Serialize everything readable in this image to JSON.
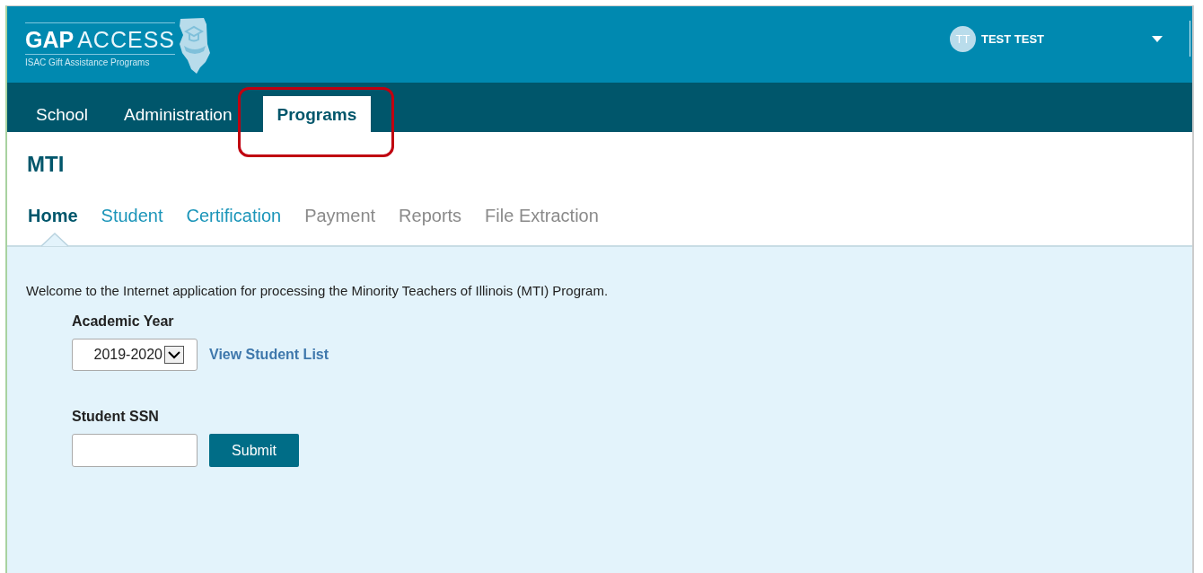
{
  "logo": {
    "brand_bold": "GAP",
    "brand_light": "ACCESS",
    "tagline": "ISAC Gift Assistance Programs"
  },
  "user": {
    "initials": "TT",
    "name": "TEST TEST"
  },
  "main_tabs": [
    {
      "label": "School",
      "selected": false
    },
    {
      "label": "Administration",
      "selected": false
    },
    {
      "label": "Programs",
      "selected": true,
      "highlighted": true
    }
  ],
  "page_title": "MTI",
  "sub_tabs": [
    {
      "label": "Home",
      "selected": true,
      "disabled": false
    },
    {
      "label": "Student",
      "selected": false,
      "disabled": false
    },
    {
      "label": "Certification",
      "selected": false,
      "disabled": false
    },
    {
      "label": "Payment",
      "selected": false,
      "disabled": true
    },
    {
      "label": "Reports",
      "selected": false,
      "disabled": true
    },
    {
      "label": "File Extraction",
      "selected": false,
      "disabled": true
    }
  ],
  "welcome": "Welcome to the Internet application for processing the Minority Teachers of Illinois (MTI) Program.",
  "academic_year": {
    "label": "Academic Year",
    "value": "2019-2020",
    "link": "View Student List"
  },
  "ssn": {
    "label": "Student SSN",
    "button": "Submit"
  }
}
